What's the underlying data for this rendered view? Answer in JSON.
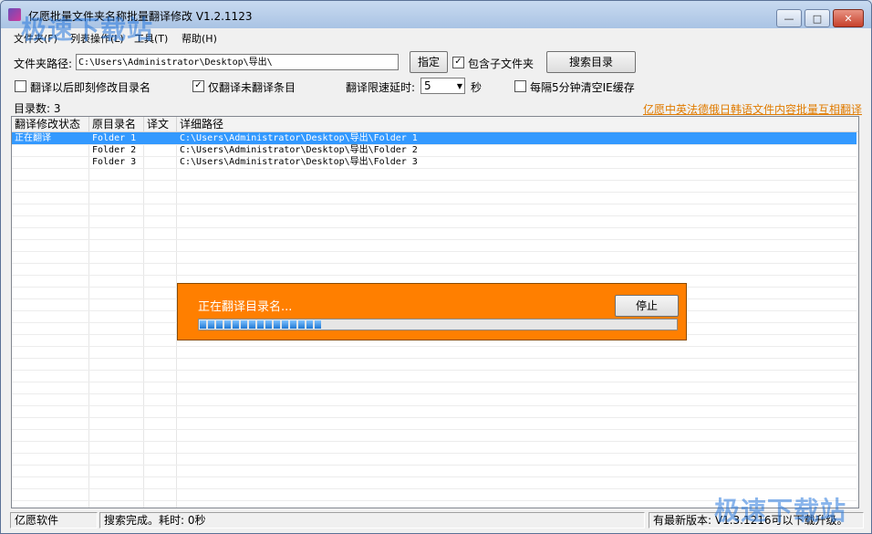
{
  "window": {
    "title": "亿愿批量文件夹名称批量翻译修改 V1.2.1123",
    "controls": {
      "minimize": "—",
      "maximize": "□",
      "close": "✕"
    }
  },
  "menu": [
    "文件夹(F)",
    "列表操作(L)",
    "工具(T)",
    "帮助(H)"
  ],
  "toolbar": {
    "path_label": "文件夹路径:",
    "path_value": "C:\\Users\\Administrator\\Desktop\\导出\\",
    "assign_button": "指定",
    "include_sub_label": "包含子文件夹",
    "search_button": "搜索目录"
  },
  "options": {
    "modify_after_label": "翻译以后即刻修改目录名",
    "only_untranslated_label": "仅翻译未翻译条目",
    "delay_label": "翻译限速延时:",
    "delay_value": "5",
    "delay_unit": "秒",
    "clear_cache_label": "每隔5分钟清空IE缓存"
  },
  "dir_count": {
    "label": "目录数:",
    "value": "3"
  },
  "promo_link": "亿愿中英法德俄日韩语文件内容批量互相翻译",
  "table": {
    "columns": [
      "翻译修改状态",
      "原目录名",
      "译文",
      "详细路径"
    ],
    "rows": [
      {
        "status": "正在翻译",
        "name": "Folder 1",
        "translation": "",
        "path": "C:\\Users\\Administrator\\Desktop\\导出\\Folder 1",
        "selected": true
      },
      {
        "status": "",
        "name": "Folder 2",
        "translation": "",
        "path": "C:\\Users\\Administrator\\Desktop\\导出\\Folder 2",
        "selected": false
      },
      {
        "status": "",
        "name": "Folder 3",
        "translation": "",
        "path": "C:\\Users\\Administrator\\Desktop\\导出\\Folder 3",
        "selected": false
      }
    ]
  },
  "progress": {
    "text": "正在翻译目录名...",
    "stop_button": "停止",
    "percent": 26,
    "color": "#ff7f00"
  },
  "status": {
    "company": "亿愿软件",
    "search_result": "搜索完成。耗时: 0秒",
    "version_info": "有最新版本: V1.3.1216可以下载升级。"
  },
  "watermark": "极速下载站"
}
